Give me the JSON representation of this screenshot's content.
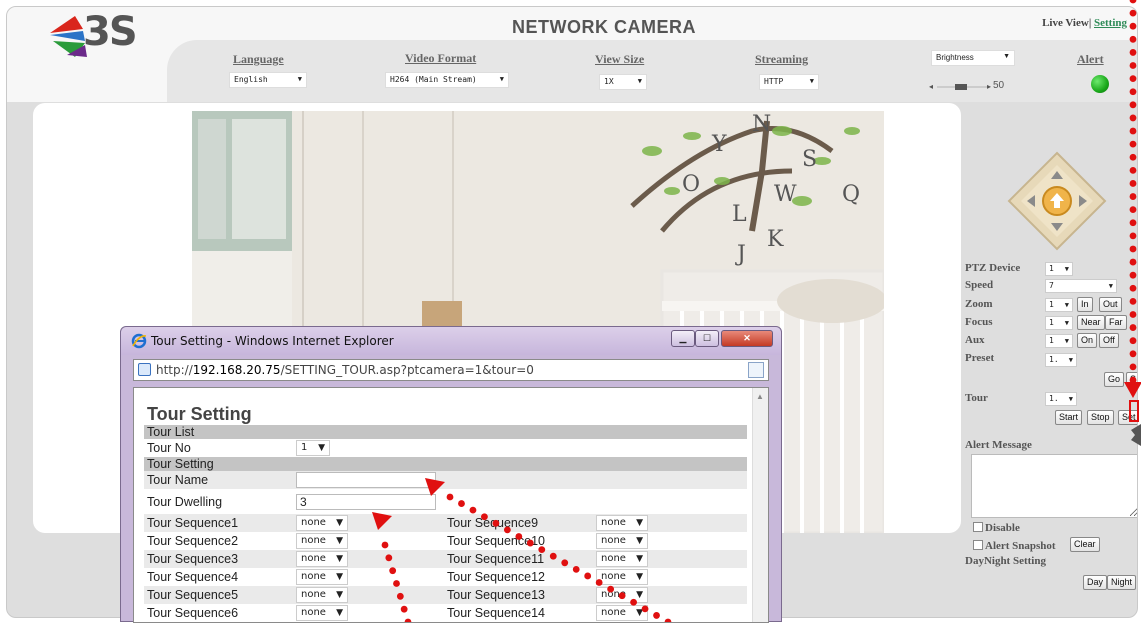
{
  "header": {
    "brand": "3S",
    "title": "NETWORK CAMERA",
    "links": {
      "live_view": "Live View",
      "separator": "|",
      "setting": "Setting"
    }
  },
  "controls": {
    "language": {
      "label": "Language",
      "value": "English"
    },
    "video_format": {
      "label": "Video Format",
      "value": "H264 (Main Stream)"
    },
    "view_size": {
      "label": "View Size",
      "value": "1X"
    },
    "streaming": {
      "label": "Streaming",
      "value": "HTTP"
    },
    "brightness": {
      "label": "Brightness",
      "value": "50"
    },
    "alert": {
      "label": "Alert",
      "status_color": "#1aa81a"
    }
  },
  "ptz": {
    "device_label": "PTZ Device",
    "device_value": "1",
    "speed_label": "Speed",
    "speed_value": "7",
    "zoom_label": "Zoom",
    "zoom_value": "1",
    "zoom_in": "In",
    "zoom_out": "Out",
    "focus_label": "Focus",
    "focus_value": "1",
    "focus_near": "Near",
    "focus_far": "Far",
    "aux_label": "Aux",
    "aux_value": "1",
    "aux_on": "On",
    "aux_off": "Off",
    "preset_label": "Preset",
    "preset_value": "1.",
    "preset_go": "Go",
    "preset_set": "S",
    "tour_label": "Tour",
    "tour_value": "1.",
    "tour_start": "Start",
    "tour_stop": "Stop",
    "tour_set": "Set"
  },
  "alert_panel": {
    "title": "Alert Message",
    "disable": "Disable",
    "snapshot": "Alert Snapshot",
    "clear": "Clear",
    "daynight_title": "DayNight Setting",
    "day": "Day",
    "night": "Night"
  },
  "popup": {
    "window_title": "Tour Setting - Windows Internet Explorer",
    "url_prefix": "http://",
    "url_host": "192.168.20.75",
    "url_path": "/SETTING_TOUR.asp?ptcamera=1&tour=0",
    "page_title": "Tour Setting",
    "section_list": "Tour List",
    "tour_no_label": "Tour No",
    "tour_no_value": "1",
    "section_setting": "Tour Setting",
    "tour_name_label": "Tour Name",
    "tour_name_value": "",
    "dwelling_label": "Tour Dwelling",
    "dwelling_value": "3",
    "sequences_left": [
      {
        "label": "Tour Sequence1",
        "value": "none"
      },
      {
        "label": "Tour Sequence2",
        "value": "none"
      },
      {
        "label": "Tour Sequence3",
        "value": "none"
      },
      {
        "label": "Tour Sequence4",
        "value": "none"
      },
      {
        "label": "Tour Sequence5",
        "value": "none"
      },
      {
        "label": "Tour Sequence6",
        "value": "none"
      }
    ],
    "sequences_right": [
      {
        "label": "Tour Sequence9",
        "value": "none"
      },
      {
        "label": "Tour Sequence10",
        "value": "none"
      },
      {
        "label": "Tour Sequence11",
        "value": "none"
      },
      {
        "label": "Tour Sequence12",
        "value": "none"
      },
      {
        "label": "Tour Sequence13",
        "value": "none"
      },
      {
        "label": "Tour Sequence14",
        "value": "none"
      }
    ]
  },
  "colors": {
    "annotation_red": "#e01010",
    "accent_green": "#2e8b57",
    "popup_frame": "#c8b8da"
  }
}
